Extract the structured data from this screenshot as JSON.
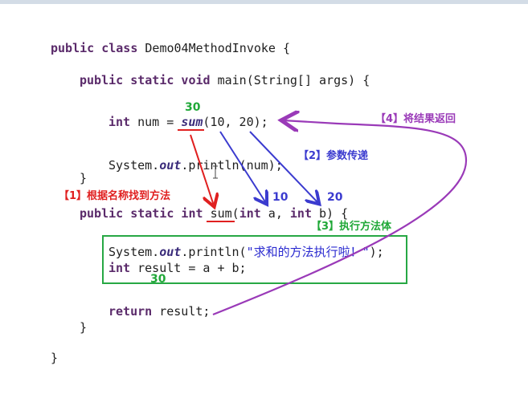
{
  "code": {
    "l1": {
      "kw": "public class",
      "rest": " Demo04MethodInvoke {"
    },
    "l2": {
      "kw": "public static void",
      "rest": " main(String[] args) {"
    },
    "l3": {
      "kw": "int",
      "pre": " num = ",
      "call": "sum",
      "args": "(10, 20);"
    },
    "l4": {
      "pre": "System.",
      "out": "out",
      "post": ".println(num);"
    },
    "l5": {
      "text": "}"
    },
    "l6": {
      "kw": "public static int",
      "sp": " ",
      "name": "sum",
      "open": "(",
      "kw_a": "int",
      "a": " a, ",
      "kw_b": "int",
      "b": " b) {"
    },
    "l7": {
      "pre": "System.",
      "out": "out",
      "mid": ".println(",
      "str": "\"求和的方法执行啦！\"",
      "post": ");"
    },
    "l8": {
      "kw": "int",
      "rest": " result = a + b;"
    },
    "l9": {
      "kw": "return",
      "rest": " result;"
    },
    "l10": {
      "text": "}"
    },
    "l11": {
      "text": "}"
    }
  },
  "annotations": {
    "step1": "【1】根据名称找到方法",
    "step2": "【2】参数传递",
    "step3": "【3】执行方法体",
    "step4": "【4】将结果返回"
  },
  "values": {
    "sum_result": "30",
    "param_a": "10",
    "param_b": "20",
    "result_value": "30"
  },
  "colors": {
    "step1": "#e02020",
    "step2": "#3b3bcf",
    "step3": "#20a838",
    "step4": "#9a3ab8",
    "value_a": "#3b3bcf",
    "value_sum": "#20a838"
  }
}
